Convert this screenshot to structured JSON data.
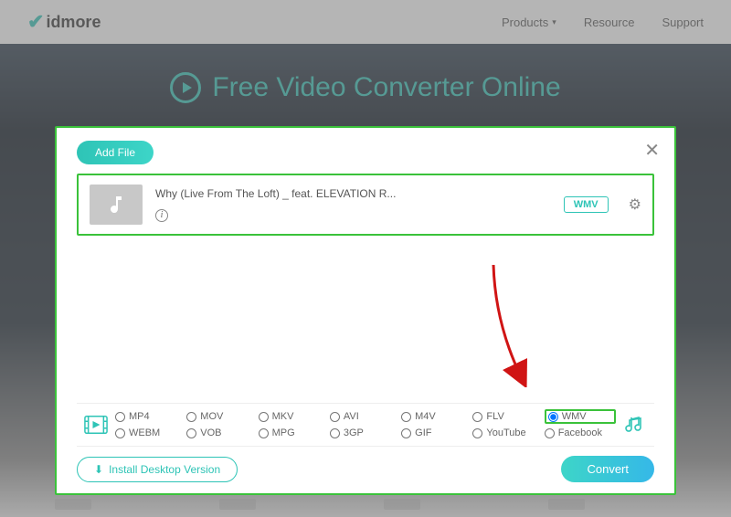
{
  "brand": "idmore",
  "nav": {
    "products": "Products",
    "resource": "Resource",
    "support": "Support"
  },
  "hero": {
    "title": "Free Video Converter Online"
  },
  "modal": {
    "add_file": "Add File",
    "file": {
      "name": "Why (Live From The Loft) _ feat. ELEVATION R...",
      "badge": "WMV"
    },
    "formats": {
      "row1": [
        "MP4",
        "MOV",
        "MKV",
        "AVI",
        "M4V",
        "FLV",
        "WMV"
      ],
      "row2": [
        "WEBM",
        "VOB",
        "MPG",
        "3GP",
        "GIF",
        "YouTube",
        "Facebook"
      ],
      "selected": "WMV"
    },
    "install": "Install Desktop Version",
    "convert": "Convert"
  }
}
